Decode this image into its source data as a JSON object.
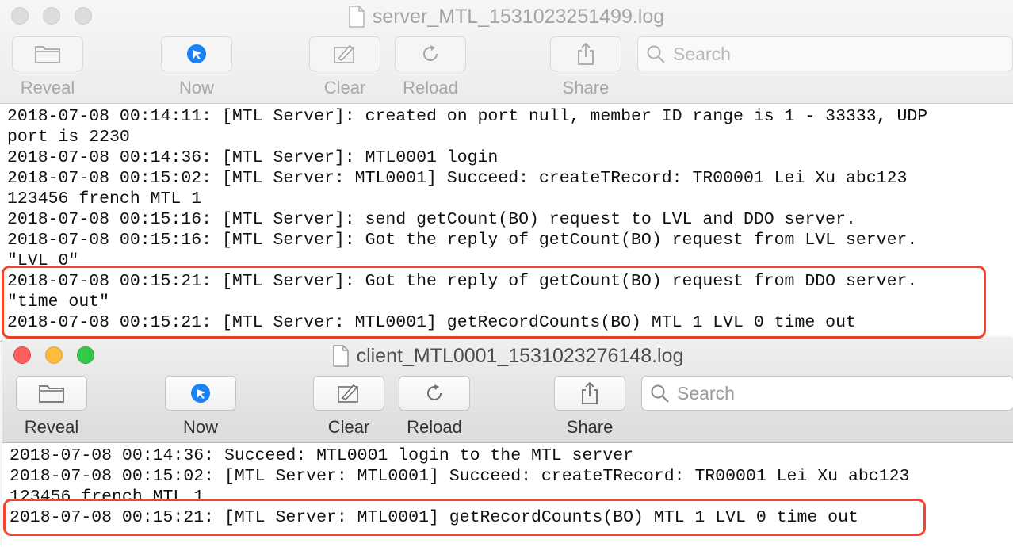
{
  "server_window": {
    "title": "server_MTL_1531023251499.log",
    "toolbar": {
      "reveal": "Reveal",
      "now": "Now",
      "clear": "Clear",
      "reload": "Reload",
      "share": "Share"
    },
    "search_placeholder": "Search",
    "log_lines": [
      "2018-07-08 00:14:11: [MTL Server]: created on port null, member ID range is 1 - 33333, UDP",
      "port is 2230",
      "2018-07-08 00:14:36: [MTL Server]: MTL0001 login",
      "2018-07-08 00:15:02: [MTL Server: MTL0001] Succeed: createTRecord: TR00001 Lei Xu abc123",
      "123456 french MTL 1",
      "2018-07-08 00:15:16: [MTL Server]: send getCount(BO) request to LVL and DDO server.",
      "2018-07-08 00:15:16: [MTL Server]: Got the reply of getCount(BO) request from LVL server.",
      "\"LVL 0\"",
      "2018-07-08 00:15:21: [MTL Server]: Got the reply of getCount(BO) request from DDO server.",
      "\"time out\"",
      "2018-07-08 00:15:21: [MTL Server: MTL0001] getRecordCounts(BO) MTL 1 LVL 0 time out"
    ]
  },
  "client_window": {
    "title": "client_MTL0001_1531023276148.log",
    "toolbar": {
      "reveal": "Reveal",
      "now": "Now",
      "clear": "Clear",
      "reload": "Reload",
      "share": "Share"
    },
    "search_placeholder": "Search",
    "log_lines": [
      "2018-07-08 00:14:36: Succeed: MTL0001 login to the MTL server",
      "2018-07-08 00:15:02: [MTL Server: MTL0001] Succeed: createTRecord: TR00001 Lei Xu abc123",
      "123456 french MTL 1",
      "2018-07-08 00:15:21: [MTL Server: MTL0001] getRecordCounts(BO) MTL 1 LVL 0 time out"
    ]
  },
  "colors": {
    "highlight": "#f4442c",
    "now_icon": "#1a82f7"
  }
}
